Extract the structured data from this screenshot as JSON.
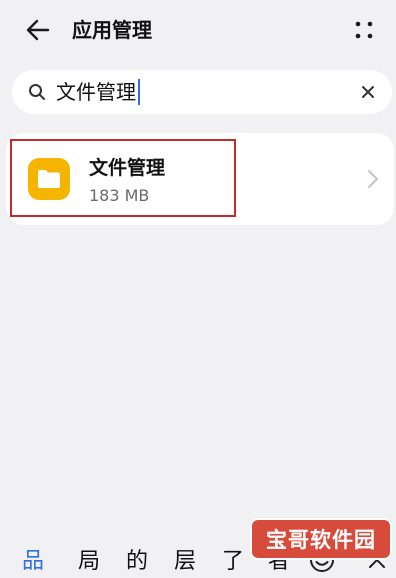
{
  "header": {
    "title": "应用管理",
    "back_icon": "back-arrow-icon",
    "more_icon": "more-grid-icon"
  },
  "search": {
    "value": "文件管理",
    "search_icon": "search-icon",
    "clear_icon": "close-icon"
  },
  "results": [
    {
      "name": "文件管理",
      "size": "183 MB",
      "icon": "folder-icon",
      "icon_color": "#f4b400"
    }
  ],
  "highlight_color": "#c32a2a",
  "watermark": "宝哥软件园",
  "candidates": [
    "品",
    "局",
    "的",
    "层",
    "了",
    "者"
  ],
  "accent_color": "#2f6fe0"
}
